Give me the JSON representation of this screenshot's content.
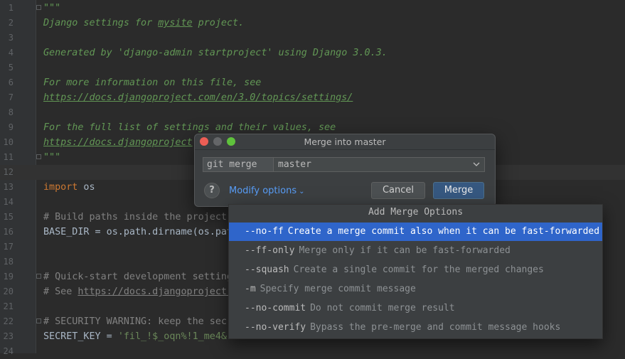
{
  "editor": {
    "lines": [
      {
        "n": "1",
        "fold": true,
        "parts": [
          {
            "t": "\"\"\"",
            "c": "c-doc"
          }
        ]
      },
      {
        "n": "2",
        "parts": [
          {
            "t": "Django settings for ",
            "c": "c-doc"
          },
          {
            "t": "mysite",
            "c": "c-link"
          },
          {
            "t": " project.",
            "c": "c-doc"
          }
        ]
      },
      {
        "n": "3",
        "parts": []
      },
      {
        "n": "4",
        "parts": [
          {
            "t": "Generated by 'django-admin startproject' using Django 3.0.3.",
            "c": "c-doc"
          }
        ]
      },
      {
        "n": "5",
        "parts": []
      },
      {
        "n": "6",
        "parts": [
          {
            "t": "For more information on this file, see",
            "c": "c-doc"
          }
        ]
      },
      {
        "n": "7",
        "parts": [
          {
            "t": "https://docs.djangoproject.com/en/3.0/topics/settings/",
            "c": "c-link"
          }
        ]
      },
      {
        "n": "8",
        "parts": []
      },
      {
        "n": "9",
        "parts": [
          {
            "t": "For the full list of settings and their values, see",
            "c": "c-doc"
          }
        ]
      },
      {
        "n": "10",
        "parts": [
          {
            "t": "https://docs.djangoproject",
            "c": "c-link"
          }
        ]
      },
      {
        "n": "11",
        "fold": true,
        "parts": [
          {
            "t": "\"\"\"",
            "c": "c-doc"
          }
        ]
      },
      {
        "n": "12",
        "current": true,
        "parts": []
      },
      {
        "n": "13",
        "parts": [
          {
            "t": "import",
            "c": "c-kw"
          },
          {
            "t": " os",
            "c": "c-id"
          }
        ]
      },
      {
        "n": "14",
        "parts": []
      },
      {
        "n": "15",
        "parts": [
          {
            "t": "# Build paths inside the project",
            "c": "c-com"
          }
        ]
      },
      {
        "n": "16",
        "parts": [
          {
            "t": "BASE_DIR = os.path.dirname(os.pat",
            "c": "c-id"
          }
        ]
      },
      {
        "n": "17",
        "parts": []
      },
      {
        "n": "18",
        "parts": []
      },
      {
        "n": "19",
        "fold": true,
        "parts": [
          {
            "t": "# Quick-start development setting",
            "c": "c-com"
          }
        ]
      },
      {
        "n": "20",
        "parts": [
          {
            "t": "# See ",
            "c": "c-com"
          },
          {
            "t": "https://docs.djangoproject.",
            "c": "c-comlink"
          }
        ]
      },
      {
        "n": "21",
        "parts": []
      },
      {
        "n": "22",
        "fold": true,
        "parts": [
          {
            "t": "# SECURITY WARNING: keep the secr",
            "c": "c-com"
          }
        ]
      },
      {
        "n": "23",
        "parts": [
          {
            "t": "SECRET_KEY = ",
            "c": "c-id"
          },
          {
            "t": "'fil_!$_oqn%!1_me4&",
            "c": "c-str"
          }
        ]
      },
      {
        "n": "24",
        "parts": []
      }
    ]
  },
  "dialog": {
    "title": "Merge into master",
    "command_prefix": "git merge",
    "branch": "master",
    "help_label": "?",
    "modify_label": "Modify options",
    "cancel_label": "Cancel",
    "merge_label": "Merge"
  },
  "options_popup": {
    "header": "Add Merge Options",
    "items": [
      {
        "flag": "--no-ff",
        "desc": "Create a merge commit also when it can be fast-forwarded",
        "selected": true
      },
      {
        "flag": "--ff-only",
        "desc": "Merge only if it can be fast-forwarded"
      },
      {
        "flag": "--squash",
        "desc": "Create a single commit for the merged changes"
      },
      {
        "flag": "-m",
        "desc": "Specify merge commit message"
      },
      {
        "flag": "--no-commit",
        "desc": "Do not commit merge result"
      },
      {
        "flag": "--no-verify",
        "desc": "Bypass the pre-merge and commit message hooks"
      }
    ]
  },
  "colors": {
    "selection": "#2f65ca",
    "link": "#589df6",
    "docstring": "#629755"
  }
}
